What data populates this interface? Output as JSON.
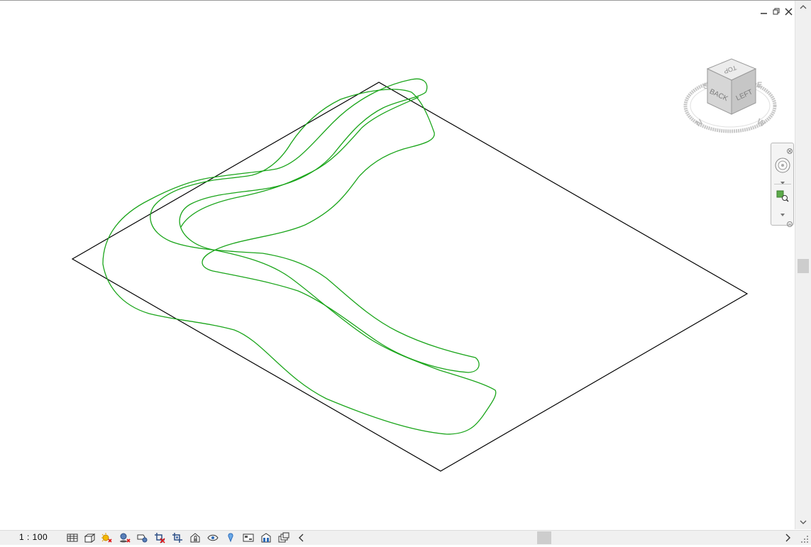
{
  "window": {
    "minimize_icon": "minimize-icon",
    "restore_icon": "restore-icon",
    "close_icon": "close-icon"
  },
  "viewcube": {
    "top_label": "TOP",
    "back_label": "BACK",
    "left_label": "LEFT",
    "compass_south": "S",
    "compass_east": "E",
    "compass_north": "N",
    "compass_west": "W"
  },
  "navigation_bar": {
    "tools": [
      "steering-wheel-icon",
      "zoom-icon"
    ]
  },
  "status_bar": {
    "scale": "1 : 100",
    "icons": [
      "detail-level-icon",
      "visual-style-icon",
      "sun-path-icon",
      "shadows-icon",
      "rendering-dialog-icon",
      "crop-view-icon",
      "show-crop-region-icon",
      "unlock-3d-view-icon",
      "temporary-hide-icon",
      "reveal-hidden-icon",
      "temporary-view-properties-icon",
      "highlight-displacement-icon",
      "reveal-constraints-icon"
    ],
    "collapse_arrow": "chevron-left-icon",
    "scroll_right_arrow": "chevron-right-icon"
  },
  "colors": {
    "contour": "#1aa51a",
    "boundary": "#000000",
    "background": "#ffffff",
    "statusbar": "#f0f0f0"
  }
}
